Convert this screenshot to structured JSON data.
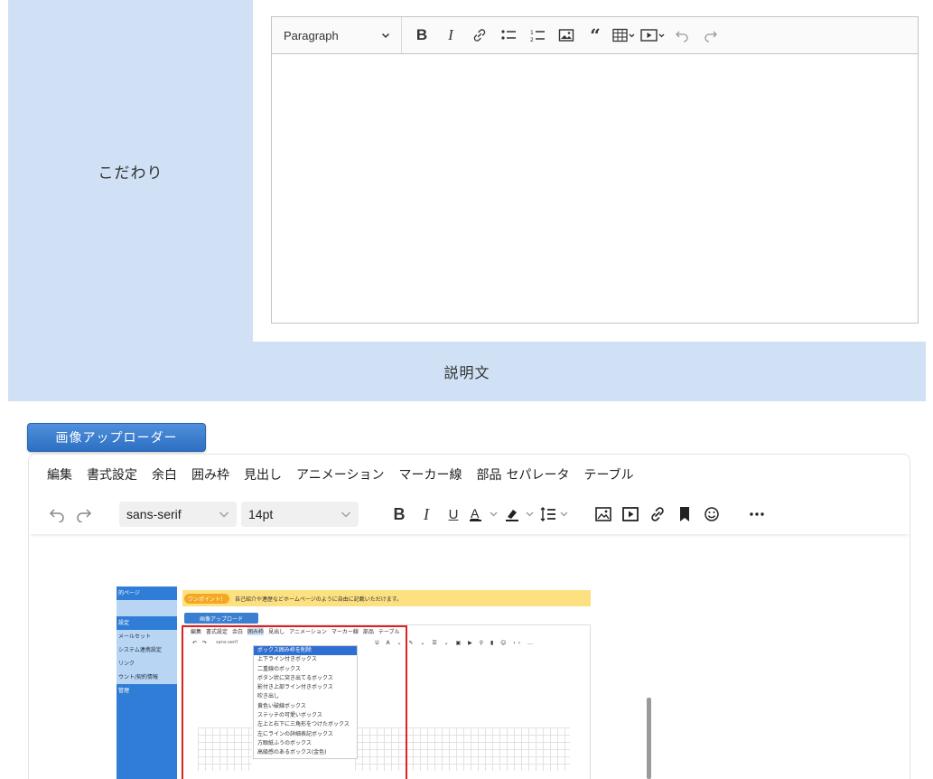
{
  "top_section": {
    "label": "こだわり"
  },
  "editor1": {
    "heading_select": "Paragraph",
    "icons": [
      "bold-icon",
      "italic-icon",
      "link-icon",
      "bulleted-list-icon",
      "numbered-list-icon",
      "image-icon",
      "quote-icon",
      "table-icon",
      "media-icon",
      "undo-icon",
      "redo-icon"
    ]
  },
  "section_bar": {
    "label": "説明文"
  },
  "uploader": {
    "label": "画像アップローダー"
  },
  "editor2": {
    "menu": [
      "編集",
      "書式設定",
      "余白",
      "囲み枠",
      "見出し",
      "アニメーション",
      "マーカー線",
      "部品",
      "セパレータ",
      "テーブル"
    ],
    "font_family": "sans-serif",
    "font_size": "14pt",
    "icons": [
      "undo-icon",
      "redo-icon",
      "bold-icon",
      "italic-icon",
      "underline-icon",
      "text-color-icon",
      "highlight-icon",
      "line-height-icon",
      "image-icon",
      "video-icon",
      "link-icon",
      "bookmark-icon",
      "emoji-icon",
      "more-icon"
    ]
  },
  "inner_screenshot": {
    "sidebar": [
      "的ページ",
      "設定",
      "メールセット",
      "システム連携設定",
      "リンク",
      "ウント/契約情報",
      "管理"
    ],
    "notice_pill": "ワンポイント！",
    "notice_text": "自己紹介や連歴などホームページのように自由に記載いただけます。",
    "upload_button": "画像アップロード",
    "menu": [
      "編集",
      "書式設定",
      "余白",
      "囲み枠",
      "見出し",
      "アニメーション",
      "マーカー線",
      "部品",
      "テーブル"
    ],
    "font_family": "sans-serif",
    "dropdown": [
      "ボックス囲み枠を削除",
      "上下ライン付きボックス",
      "二重線のボックス",
      "ボタン状に突き出てるボックス",
      "影付き上部ライン付きボックス",
      "吹き出し",
      "黄色い破線ボックス",
      "ステッチの可愛いボックス",
      "左上と右下に三角形をつけたボックス",
      "左にラインの詳細表記ボックス",
      "方眼紙ふうのボックス",
      "高級感のあるボックス(金色)"
    ]
  }
}
